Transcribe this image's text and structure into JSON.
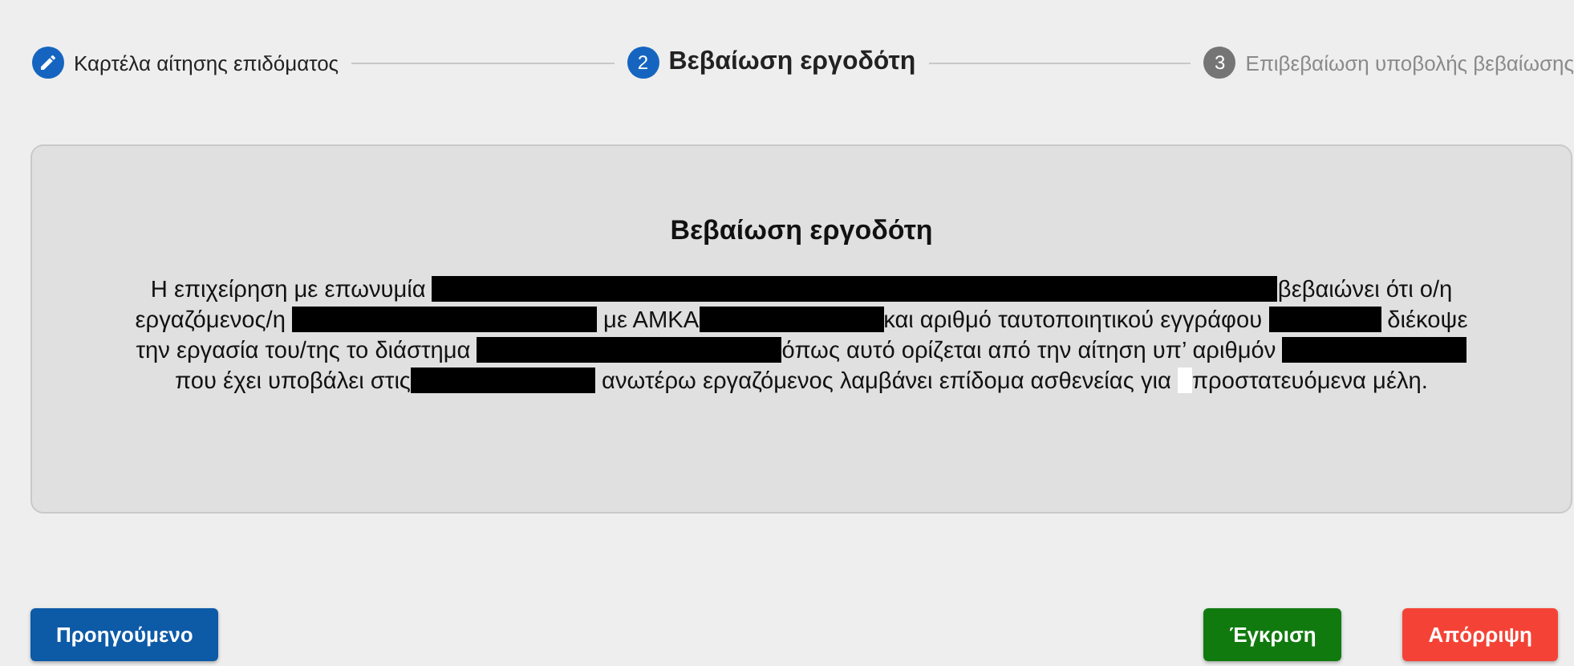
{
  "stepper": [
    {
      "kind": "edit",
      "label": "Καρτέλα αίτησης επιδόματος",
      "done": true,
      "active": false
    },
    {
      "kind": "number",
      "number": "2",
      "label": "Βεβαίωση εργοδότη",
      "done": false,
      "active": true
    },
    {
      "kind": "number",
      "number": "3",
      "label": "Επιβεβαίωση υποβολής βεβαίωσης",
      "done": false,
      "active": false
    }
  ],
  "card": {
    "title": "Βεβαίωση εργοδότη",
    "paragraph": [
      {
        "kind": "text",
        "text": "Η επιχείρηση με επωνυμία "
      },
      {
        "kind": "redacted_wide"
      },
      {
        "kind": "text",
        "text": "βεβαιώνει ότι ο/η εργαζόμενος/η "
      },
      {
        "kind": "redacted_long"
      },
      {
        "kind": "text",
        "text": " με ΑΜΚΑ"
      },
      {
        "kind": "redacted"
      },
      {
        "kind": "text",
        "text": "και αριθμό ταυτοποιητικού εγγράφου "
      },
      {
        "kind": "redacted_short"
      },
      {
        "kind": "text",
        "text": " διέκοψε την εργασία του/της το διάστημα "
      },
      {
        "kind": "redacted_long"
      },
      {
        "kind": "text",
        "text": "όπως αυτό ορίζεται από την αίτηση υπ’ αριθμόν "
      },
      {
        "kind": "redacted"
      },
      {
        "kind": "text",
        "text": " που έχει υποβάλει στις"
      },
      {
        "kind": "redacted"
      },
      {
        "kind": "text",
        "text": " ανωτέρω εργαζόμενος λαμβάνει επίδομα ασθενείας για "
      },
      {
        "kind": "blank"
      },
      {
        "kind": "text",
        "text": "προστατευόμενα μέλη."
      }
    ]
  },
  "buttons": [
    {
      "label": "Προηγούμενο",
      "kind": "previous"
    },
    {
      "label": "Έγκριση",
      "kind": "approve"
    },
    {
      "label": "Απόρριψη",
      "kind": "reject"
    }
  ]
}
